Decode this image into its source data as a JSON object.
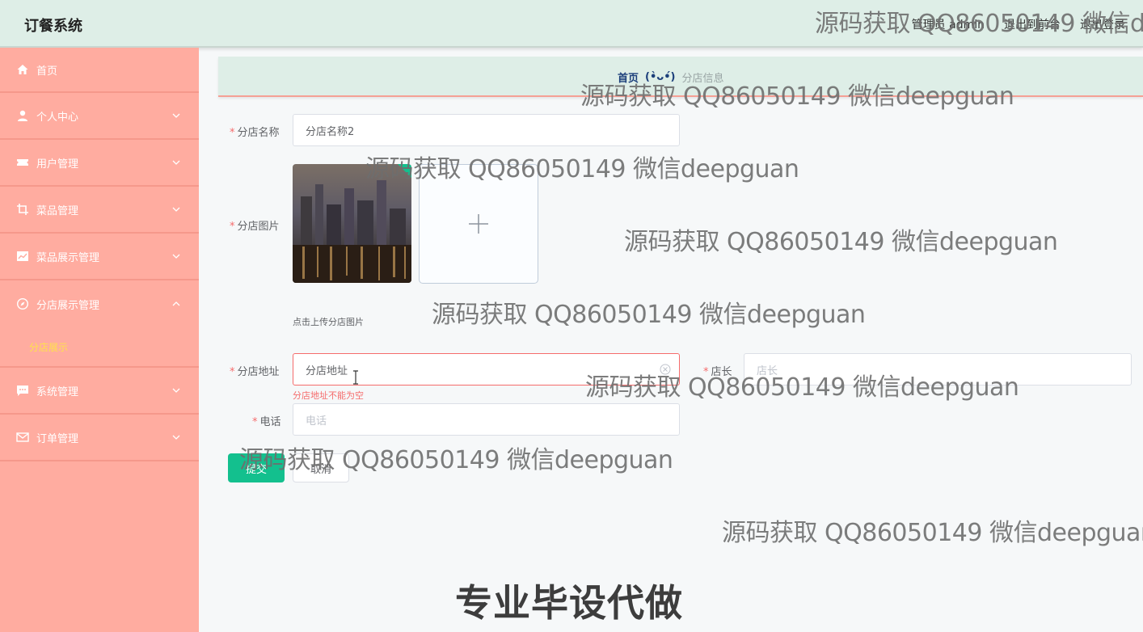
{
  "header": {
    "brand": "订餐系统",
    "admin_label": "管理员 admin",
    "to_front_label": "退出到前台",
    "logout_label": "退出登录"
  },
  "sidebar": {
    "items": [
      {
        "label": "首页",
        "icon": "home-icon",
        "has_arrow": false
      },
      {
        "label": "个人中心",
        "icon": "user-icon",
        "has_arrow": true
      },
      {
        "label": "用户管理",
        "icon": "ticket-icon",
        "has_arrow": true
      },
      {
        "label": "菜品管理",
        "icon": "crop-icon",
        "has_arrow": true
      },
      {
        "label": "菜品展示管理",
        "icon": "chart-icon",
        "has_arrow": true
      },
      {
        "label": "分店展示管理",
        "icon": "compass-icon",
        "has_arrow": true,
        "expanded": true
      },
      {
        "label": "系统管理",
        "icon": "chat-icon",
        "has_arrow": true
      },
      {
        "label": "订单管理",
        "icon": "mail-icon",
        "has_arrow": true
      }
    ],
    "submenu_label": "分店展示"
  },
  "breadcrumb": {
    "home": "首页",
    "face": "(•̀ᴗ•́)",
    "current": "分店信息"
  },
  "form": {
    "name_label": "分店名称",
    "name_value": "分店名称2",
    "image_label": "分店图片",
    "image_tip": "点击上传分店图片",
    "address_label": "分店地址",
    "address_value": "分店地址",
    "address_error": "分店地址不能为空",
    "manager_label": "店长",
    "manager_placeholder": "店长",
    "phone_label": "电话",
    "phone_placeholder": "电话",
    "submit_label": "提交",
    "cancel_label": "取消"
  },
  "watermark": {
    "text": "源码获取 QQ86050149 微信deepguan",
    "top_text": "源码获取 QQ86050149 微信d",
    "tail_text": "源码获取 QQ86050149 微信deepguar",
    "big_text": "专业毕设代做"
  },
  "colors": {
    "sidebar_bg": "#ffaca0",
    "header_bg": "#deeee7",
    "primary": "#13c08e",
    "submenu_active": "#ffe24a",
    "error": "#f56c6c"
  }
}
